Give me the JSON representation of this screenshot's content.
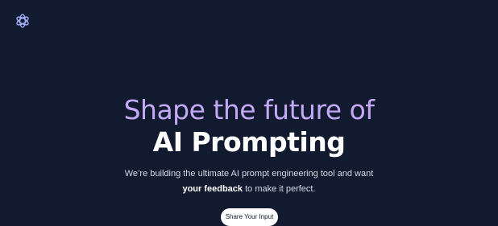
{
  "header": {
    "logo_icon": "ai-logo-icon"
  },
  "hero": {
    "headline_line1": "Shape the future of",
    "headline_line2": "AI Prompting",
    "subtitle_before": "We’re building the ultimate AI prompt engineering tool and want ",
    "subtitle_emphasis": "your feedback",
    "subtitle_after": " to make it perfect.",
    "cta_label": "Share Your Input"
  },
  "colors": {
    "background": "#111a2e",
    "accent": "#c4a9f7",
    "text": "#ffffff"
  }
}
